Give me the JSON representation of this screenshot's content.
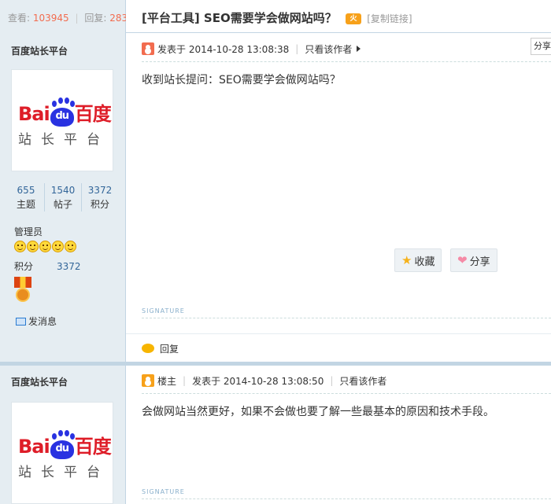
{
  "thread": {
    "views_label": "查看:",
    "views": "103945",
    "replies_label": "回复:",
    "replies": "283",
    "title": "[平台工具] SEO需要学会做网站吗？",
    "hot_badge": "火",
    "copy_link": "[复制链接]"
  },
  "logo": {
    "bai": "Bai",
    "du": "du",
    "cn": "百度",
    "sub": "站长平台"
  },
  "posts": [
    {
      "author": "百度站长平台",
      "stats": [
        {
          "value": "655",
          "label": "主题"
        },
        {
          "value": "1540",
          "label": "帖子"
        },
        {
          "value": "3372",
          "label": "积分"
        }
      ],
      "role": "管理员",
      "points_label": "积分",
      "points": "3372",
      "send_message": "发消息",
      "posted_at": "发表于 2014-10-28 13:08:38",
      "only_author": "只看该作者",
      "share_tab": "分享",
      "content": "收到站长提问：SEO需要学会做网站吗？",
      "fav_button": "收藏",
      "share_button": "分享",
      "signature": "SIGNATURE",
      "reply": "回复"
    },
    {
      "author": "百度站长平台",
      "floor": "楼主",
      "posted_at": "发表于 2014-10-28 13:08:50",
      "only_author": "只看该作者",
      "content": "会做网站当然更好，如果不会做也要了解一些最基本的原因和技术手段。",
      "signature": "SIGNATURE"
    }
  ]
}
